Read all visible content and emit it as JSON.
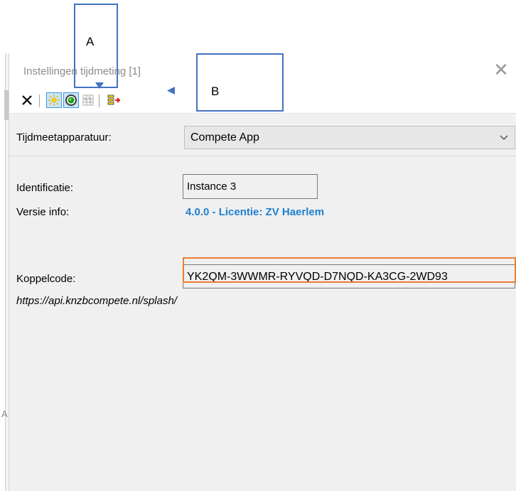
{
  "window": {
    "title": "Instellingen tijdmeting [1]"
  },
  "toolbar": {
    "icons": [
      "close-x-icon",
      "sun-icon",
      "target-icon",
      "grid-icon",
      "export-icon"
    ]
  },
  "form": {
    "device_label": "Tijdmeetapparatuur:",
    "device_value": "Compete App",
    "identification_label": "Identificatie:",
    "identification_value": "Instance 3",
    "version_label": "Versie info:",
    "version_value": "4.0.0 - Licentie: ZV Haerlem",
    "pairing_label": "Koppelcode:",
    "pairing_value": "YK2QM-3WWMR-RYVQD-D7NQD-KA3CG-2WD93",
    "url": "https://api.knzbcompete.nl/splash/"
  },
  "annotations": {
    "a": "A",
    "b": "B"
  },
  "colors": {
    "accent_blue": "#1e7fd0",
    "annotation_blue": "#4472c4",
    "annotation_orange": "#ed7d31"
  }
}
